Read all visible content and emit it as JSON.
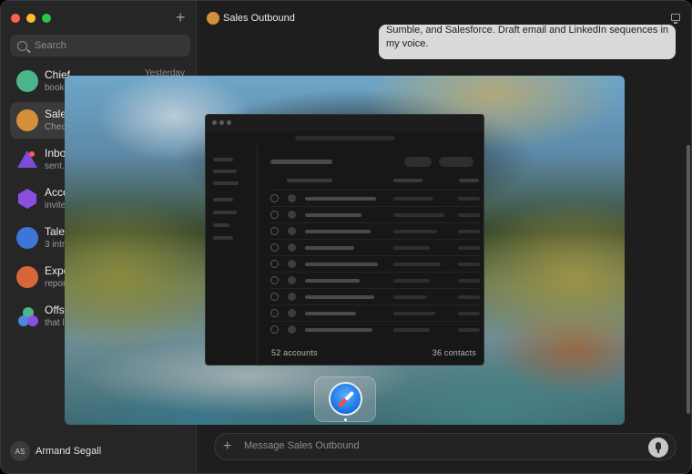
{
  "app": {
    "top_plus_label": "+"
  },
  "sidebar": {
    "search_placeholder": "Search",
    "conversations": [
      {
        "name": "Chief",
        "preview": "book",
        "time": "Yesterday",
        "color": "#4db58c"
      },
      {
        "name": "Sales",
        "preview": "Chec",
        "time": "",
        "color": "#d48f3b"
      },
      {
        "name": "Inbox",
        "preview": "sent.",
        "time": "",
        "color": "#7a4dd6"
      },
      {
        "name": "Acco",
        "preview": "invite",
        "time": "",
        "color": "#8a4ee0"
      },
      {
        "name": "Talen",
        "preview": "3 intr",
        "time": "",
        "color": "#3f74d8"
      },
      {
        "name": "Expe",
        "preview": "repor",
        "time": "",
        "color": "#d8663a"
      },
      {
        "name": "Offsi",
        "preview": "that l",
        "time": "",
        "color": "#4a8ad8"
      }
    ],
    "user": {
      "initials": "AS",
      "name": "Armand Segall"
    }
  },
  "header": {
    "title": "Sales Outbound",
    "avatar_color": "#d48f3b"
  },
  "chat": {
    "message_line1": "Sumble, and Salesforce. Draft email and LinkedIn sequences in",
    "message_line2": "my voice."
  },
  "composer": {
    "plus_label": "+",
    "placeholder": "Message Sales Outbound"
  },
  "overlay": {
    "screenshot": {
      "accounts_label": "52 accounts",
      "contacts_label": "36 contacts"
    },
    "dock": {
      "app_icon": "safari-compass-icon"
    }
  }
}
